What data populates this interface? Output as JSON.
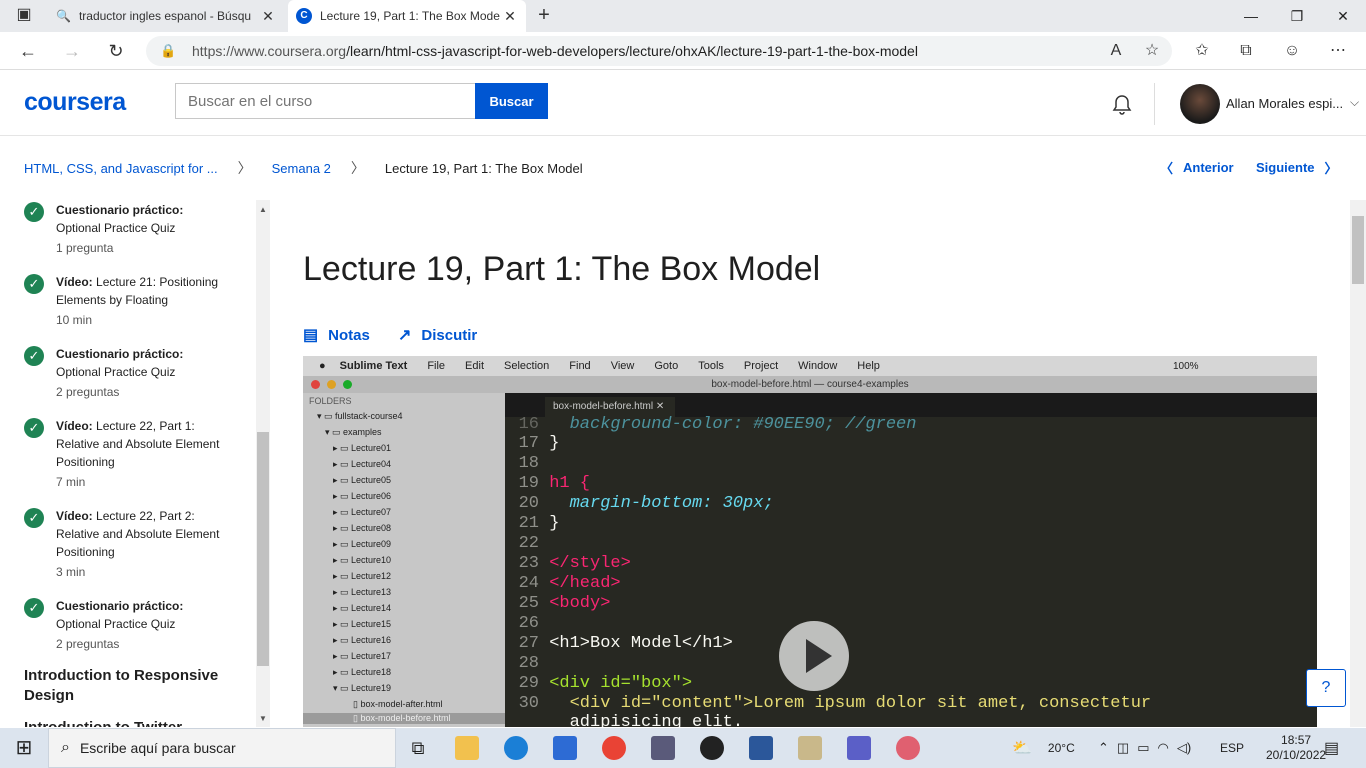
{
  "browser": {
    "tabs": [
      {
        "title": "traductor ingles espanol - Búsqu",
        "active": false
      },
      {
        "title": "Lecture 19, Part 1: The Box Mode",
        "active": true
      }
    ],
    "url_host": "https://www.coursera.org",
    "url_path": "/learn/html-css-javascript-for-web-developers/lecture/ohxAK/lecture-19-part-1-the-box-model"
  },
  "header": {
    "logo": "coursera",
    "search_placeholder": "Buscar en el curso",
    "search_button": "Buscar",
    "username": "Allan Morales espi..."
  },
  "breadcrumb": {
    "course": "HTML, CSS, and Javascript for ...",
    "week": "Semana 2",
    "current": "Lecture 19, Part 1: The Box Model"
  },
  "nav": {
    "prev": "Anterior",
    "next": "Siguiente"
  },
  "sidebar": {
    "items": [
      {
        "kind": "Cuestionario práctico:",
        "title": "Optional Practice Quiz",
        "meta": "1 pregunta"
      },
      {
        "kind": "Vídeo:",
        "title": "Lecture 21: Positioning Elements by Floating",
        "meta": "10 min"
      },
      {
        "kind": "Cuestionario práctico:",
        "title": "Optional Practice Quiz",
        "meta": "2 preguntas"
      },
      {
        "kind": "Vídeo:",
        "title": "Lecture 22, Part 1: Relative and Absolute Element Positioning",
        "meta": "7 min"
      },
      {
        "kind": "Vídeo:",
        "title": "Lecture 22, Part 2: Relative and Absolute Element Positioning",
        "meta": "3 min"
      },
      {
        "kind": "Cuestionario práctico:",
        "title": "Optional Practice Quiz",
        "meta": "2 preguntas"
      }
    ],
    "section1": "Introduction to Responsive Design",
    "section2": "Introduction to Twitter"
  },
  "lecture": {
    "title": "Lecture 19, Part 1: The Box Model",
    "notes": "Notas",
    "discuss": "Discutir"
  },
  "video": {
    "menu": [
      "Sublime Text",
      "File",
      "Edit",
      "Selection",
      "Find",
      "View",
      "Goto",
      "Tools",
      "Project",
      "Window",
      "Help"
    ],
    "battery": "100%",
    "window_title": "box-model-before.html — course4-examples",
    "tab": "box-model-before.html",
    "folders_header": "FOLDERS",
    "tree": [
      "fullstack-course4",
      "examples",
      "Lecture01",
      "Lecture04",
      "Lecture05",
      "Lecture06",
      "Lecture07",
      "Lecture08",
      "Lecture09",
      "Lecture10",
      "Lecture12",
      "Lecture13",
      "Lecture14",
      "Lecture15",
      "Lecture16",
      "Lecture17",
      "Lecture18",
      "Lecture19",
      "box-model-after.html",
      "box-model-before.html"
    ],
    "code": [
      {
        "n": "16",
        "t": "  background-color: #90EE90; //green"
      },
      {
        "n": "17",
        "t": "}"
      },
      {
        "n": "18",
        "t": ""
      },
      {
        "n": "19",
        "t": "h1 {"
      },
      {
        "n": "20",
        "t": "  margin-bottom: 30px;"
      },
      {
        "n": "21",
        "t": "}"
      },
      {
        "n": "22",
        "t": ""
      },
      {
        "n": "23",
        "t": "</style>"
      },
      {
        "n": "24",
        "t": "</head>"
      },
      {
        "n": "25",
        "t": "<body>"
      },
      {
        "n": "26",
        "t": ""
      },
      {
        "n": "27",
        "t": "<h1>Box Model</h1>"
      },
      {
        "n": "28",
        "t": ""
      },
      {
        "n": "29",
        "t": "<div id=\"box\">"
      },
      {
        "n": "30",
        "t": "  <div id=\"content\">Lorem ipsum dolor sit amet, consectetur"
      },
      {
        "n": "",
        "t": "  adipisicing elit."
      }
    ]
  },
  "help": "?",
  "taskbar": {
    "search": "Escribe aquí para buscar",
    "weather": "20°C",
    "lang": "ESP",
    "time": "18:57",
    "date": "20/10/2022"
  },
  "colors": {
    "brand": "#0056d2",
    "check": "#1f8354"
  }
}
